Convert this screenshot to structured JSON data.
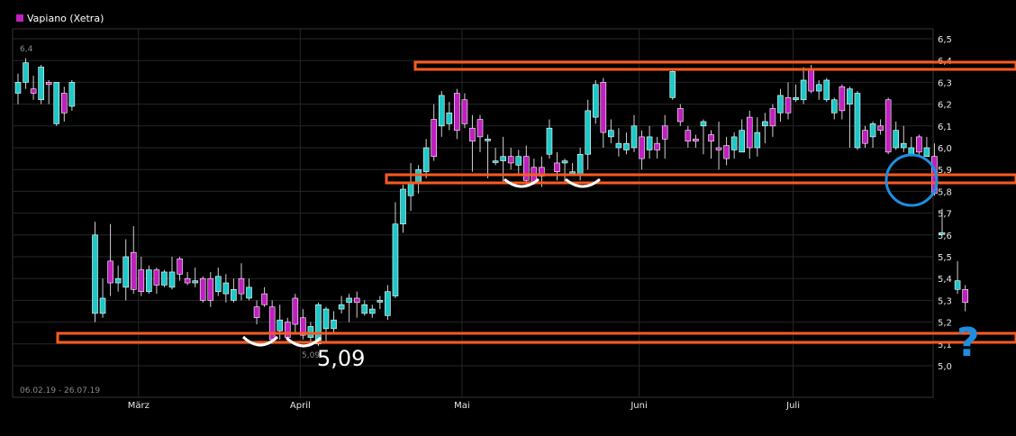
{
  "chart_data": {
    "type": "candlestick",
    "title": "Vapiano (Xetra)",
    "date_range": "06.02.19 - 26.07.19",
    "ylim": [
      4.92,
      6.58
    ],
    "y_ticks": [
      "6,5",
      "6,4",
      "6,3",
      "6,2",
      "6,1",
      "6,0",
      "5,9",
      "5,8",
      "5,7",
      "5,6",
      "5,5",
      "5,4",
      "5,3",
      "5,2",
      "5,1",
      "5,0"
    ],
    "x_months": [
      {
        "label": "März",
        "index": 16
      },
      {
        "label": "April",
        "index": 37
      },
      {
        "label": "Mai",
        "index": 58
      },
      {
        "label": "Juni",
        "index": 81
      },
      {
        "label": "Juli",
        "index": 101
      }
    ],
    "grid": true,
    "legend": "top-left",
    "colors": {
      "up": "#1ec8c8",
      "down": "#c020c0",
      "highlight": "#ff5a1f",
      "circle": "#1f8ee0",
      "smile": "#ffffff"
    },
    "labels": {
      "top_left_value": "6,4",
      "low_value": "5,09",
      "annotation": "5,09",
      "question": "?"
    },
    "candles": [
      [
        6.25,
        6.3,
        6.34,
        6.2
      ],
      [
        6.3,
        6.39,
        6.41,
        6.27
      ],
      [
        6.27,
        6.25,
        6.33,
        6.22
      ],
      [
        6.22,
        6.37,
        6.38,
        6.2
      ],
      [
        6.3,
        6.29,
        6.31,
        6.2
      ],
      [
        6.11,
        6.3,
        6.3,
        6.1
      ],
      [
        6.25,
        6.16,
        6.28,
        6.12
      ],
      [
        6.19,
        6.3,
        6.31,
        6.17
      ],
      [
        null,
        null,
        null,
        null
      ],
      [
        null,
        null,
        null,
        null
      ],
      [
        5.24,
        5.6,
        5.66,
        5.2
      ],
      [
        5.24,
        5.31,
        5.4,
        5.22
      ],
      [
        5.48,
        5.38,
        5.65,
        5.32
      ],
      [
        5.38,
        5.4,
        5.46,
        5.34
      ],
      [
        5.36,
        5.5,
        5.58,
        5.3
      ],
      [
        5.52,
        5.35,
        5.64,
        5.33
      ],
      [
        5.44,
        5.34,
        5.5,
        5.32
      ],
      [
        5.34,
        5.44,
        5.46,
        5.33
      ],
      [
        5.44,
        5.37,
        5.45,
        5.33
      ],
      [
        5.37,
        5.43,
        5.44,
        5.36
      ],
      [
        5.36,
        5.43,
        5.5,
        5.35
      ],
      [
        5.49,
        5.42,
        5.5,
        5.39
      ],
      [
        5.4,
        5.38,
        5.43,
        5.37
      ],
      [
        5.38,
        5.39,
        5.45,
        5.36
      ],
      [
        5.4,
        5.3,
        5.41,
        5.29
      ],
      [
        5.4,
        5.3,
        5.43,
        5.27
      ],
      [
        5.34,
        5.41,
        5.45,
        5.32
      ],
      [
        5.33,
        5.38,
        5.42,
        5.29
      ],
      [
        5.3,
        5.35,
        5.4,
        5.29
      ],
      [
        5.4,
        5.33,
        5.47,
        5.3
      ],
      [
        5.31,
        5.36,
        5.4,
        5.3
      ],
      [
        5.27,
        5.22,
        5.3,
        5.19
      ],
      [
        5.33,
        5.28,
        5.36,
        5.27
      ],
      [
        5.27,
        5.12,
        5.3,
        5.1
      ],
      [
        5.16,
        5.21,
        5.28,
        5.12
      ],
      [
        5.2,
        5.13,
        5.22,
        5.11
      ],
      [
        5.31,
        5.19,
        5.33,
        5.15
      ],
      [
        5.22,
        5.14,
        5.26,
        5.12
      ],
      [
        5.13,
        5.18,
        5.2,
        5.09
      ],
      [
        5.1,
        5.28,
        5.29,
        5.09
      ],
      [
        5.17,
        5.26,
        5.27,
        5.11
      ],
      [
        5.17,
        5.21,
        5.25,
        5.15
      ],
      [
        5.26,
        5.28,
        5.32,
        5.24
      ],
      [
        5.29,
        5.31,
        5.33,
        5.2
      ],
      [
        5.31,
        5.29,
        5.34,
        5.22
      ],
      [
        5.24,
        5.28,
        5.3,
        5.23
      ],
      [
        5.24,
        5.26,
        5.28,
        5.22
      ],
      [
        5.3,
        5.3,
        5.32,
        5.26
      ],
      [
        5.23,
        5.34,
        5.37,
        5.21
      ],
      [
        5.32,
        5.65,
        5.75,
        5.31
      ],
      [
        5.65,
        5.81,
        5.83,
        5.61
      ],
      [
        5.78,
        5.84,
        5.93,
        5.71
      ],
      [
        5.84,
        5.9,
        5.92,
        5.79
      ],
      [
        5.89,
        6.0,
        6.04,
        5.86
      ],
      [
        6.13,
        5.96,
        6.2,
        5.94
      ],
      [
        6.1,
        6.24,
        6.26,
        6.05
      ],
      [
        6.11,
        6.16,
        6.21,
        6.08
      ],
      [
        6.25,
        6.08,
        6.27,
        6.04
      ],
      [
        6.22,
        6.11,
        6.25,
        6.09
      ],
      [
        6.09,
        6.03,
        6.15,
        5.89
      ],
      [
        6.13,
        6.05,
        6.15,
        5.98
      ],
      [
        6.04,
        6.04,
        6.06,
        5.86
      ],
      [
        5.94,
        5.94,
        6.0,
        5.92
      ],
      [
        5.94,
        5.96,
        6.05,
        5.84
      ],
      [
        5.96,
        5.93,
        6.0,
        5.9
      ],
      [
        5.92,
        5.96,
        5.99,
        5.88
      ],
      [
        5.96,
        5.85,
        6.01,
        5.83
      ],
      [
        5.91,
        5.84,
        5.95,
        5.83
      ],
      [
        5.91,
        5.87,
        5.96,
        5.82
      ],
      [
        5.97,
        6.09,
        6.13,
        5.95
      ],
      [
        5.93,
        5.89,
        5.98,
        5.85
      ],
      [
        5.93,
        5.94,
        5.95,
        5.84
      ],
      [
        5.89,
        5.89,
        5.93,
        5.87
      ],
      [
        5.88,
        5.97,
        6.0,
        5.85
      ],
      [
        5.97,
        6.17,
        6.22,
        5.9
      ],
      [
        6.14,
        6.29,
        6.31,
        6.11
      ],
      [
        6.3,
        6.07,
        6.32,
        6.0
      ],
      [
        6.05,
        6.08,
        6.13,
        6.02
      ],
      [
        6.0,
        6.02,
        6.09,
        5.96
      ],
      [
        5.99,
        6.02,
        6.07,
        5.97
      ],
      [
        6.0,
        6.1,
        6.15,
        5.98
      ],
      [
        6.05,
        5.95,
        6.08,
        5.9
      ],
      [
        5.99,
        6.05,
        6.1,
        5.95
      ],
      [
        6.02,
        5.99,
        6.05,
        5.95
      ],
      [
        6.1,
        6.04,
        6.15,
        5.95
      ],
      [
        6.23,
        6.35,
        6.36,
        6.22
      ],
      [
        6.18,
        6.12,
        6.2,
        6.1
      ],
      [
        6.08,
        6.03,
        6.1,
        6.0
      ],
      [
        6.04,
        6.03,
        6.06,
        6.0
      ],
      [
        6.1,
        6.12,
        6.13,
        5.97
      ],
      [
        6.06,
        6.03,
        6.08,
        5.95
      ],
      [
        6.0,
        5.99,
        6.12,
        5.9
      ],
      [
        6.01,
        5.95,
        6.05,
        5.92
      ],
      [
        5.99,
        6.05,
        6.07,
        5.95
      ],
      [
        5.98,
        6.08,
        6.13,
        5.98
      ],
      [
        6.14,
        6.0,
        6.17,
        5.95
      ],
      [
        6.0,
        6.07,
        6.14,
        5.96
      ],
      [
        6.1,
        6.12,
        6.16,
        6.02
      ],
      [
        6.18,
        6.1,
        6.2,
        6.05
      ],
      [
        6.16,
        6.24,
        6.27,
        6.12
      ],
      [
        6.23,
        6.16,
        6.3,
        6.13
      ],
      [
        6.22,
        6.23,
        6.29,
        6.21
      ],
      [
        6.22,
        6.31,
        6.37,
        6.2
      ],
      [
        6.36,
        6.26,
        6.38,
        6.25
      ],
      [
        6.26,
        6.29,
        6.31,
        6.22
      ],
      [
        6.22,
        6.31,
        6.32,
        6.21
      ],
      [
        6.16,
        6.22,
        6.23,
        6.13
      ],
      [
        6.28,
        6.17,
        6.29,
        6.13
      ],
      [
        6.2,
        6.27,
        6.28,
        6.0
      ],
      [
        6.0,
        6.25,
        6.26,
        5.99
      ],
      [
        6.08,
        6.02,
        6.1,
        6.0
      ],
      [
        6.05,
        6.11,
        6.12,
        6.0
      ],
      [
        6.1,
        6.08,
        6.13,
        6.06
      ],
      [
        6.22,
        5.98,
        6.23,
        5.97
      ],
      [
        6.0,
        6.08,
        6.12,
        5.99
      ],
      [
        6.0,
        6.02,
        6.1,
        5.98
      ],
      [
        5.97,
        6.0,
        6.05,
        5.96
      ],
      [
        6.05,
        5.98,
        6.06,
        5.96
      ],
      [
        5.96,
        6.0,
        6.05,
        5.96
      ],
      [
        5.96,
        5.79,
        6.02,
        5.78
      ],
      [
        5.61,
        5.61,
        5.72,
        5.6
      ],
      [
        null,
        null,
        null,
        null
      ],
      [
        5.35,
        5.39,
        5.48,
        5.33
      ],
      [
        5.35,
        5.29,
        5.37,
        5.25
      ]
    ]
  }
}
